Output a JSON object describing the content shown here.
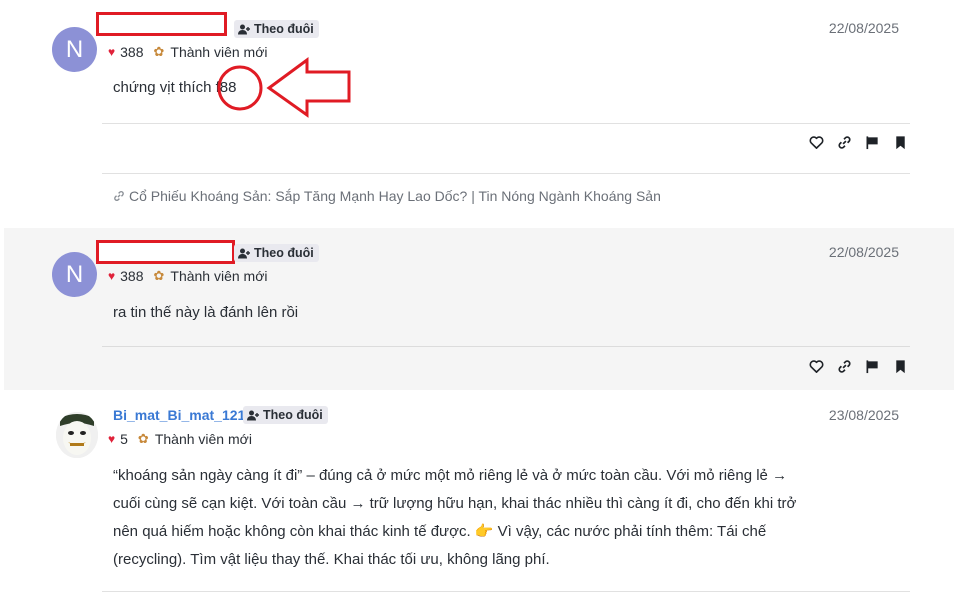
{
  "posts": [
    {
      "avatar_letter": "N",
      "follow_label": "Theo đuôi",
      "date": "22/08/2025",
      "likes": "388",
      "rank": "Thành viên mới",
      "text_before": "chứng vịt thích ",
      "highlight": "f88"
    },
    {
      "avatar_letter": "N",
      "follow_label": "Theo đuôi",
      "date": "22/08/2025",
      "likes": "388",
      "rank": "Thành viên mới",
      "text": "ra tin thế này là đánh lên rồi"
    },
    {
      "username": "Bi_mat_Bi_mat_121",
      "follow_label": "Theo đuôi",
      "date": "23/08/2025",
      "likes": "5",
      "rank": "Thành viên mới",
      "paragraph_lines": [
        "“khoáng sản ngày càng ít đi” – đúng cả ở mức một mỏ riêng lẻ và ở mức toàn cầu. Với mỏ riêng lẻ →",
        "cuối cùng sẽ cạn kiệt. Với toàn cầu → trữ lượng hữu hạn, khai thác nhiều thì càng ít đi, cho đến khi trở",
        "nên quá hiếm hoặc không còn khai thác kinh tế được. 👉 Vì vậy, các nước phải tính thêm: Tái chế",
        "(recycling). Tìm vật liệu thay thế. Khai thác tối ưu, không lãng phí."
      ]
    }
  ],
  "related_link": "Cổ Phiếu Khoáng Sản: Sắp Tăng Mạnh Hay Lao Dốc? | Tin Nóng Ngành Khoáng Sản",
  "colors": {
    "avatar": "#8c91d6",
    "username": "#3a79d4",
    "heart": "#e0223a",
    "annotation": "#e01b24",
    "alt_background": "#f5f5f5"
  },
  "icons": [
    "add-user-icon",
    "heart-icon",
    "rank-icon",
    "like-outline-icon",
    "link-icon",
    "flag-icon",
    "bookmark-icon",
    "link-small-icon"
  ]
}
